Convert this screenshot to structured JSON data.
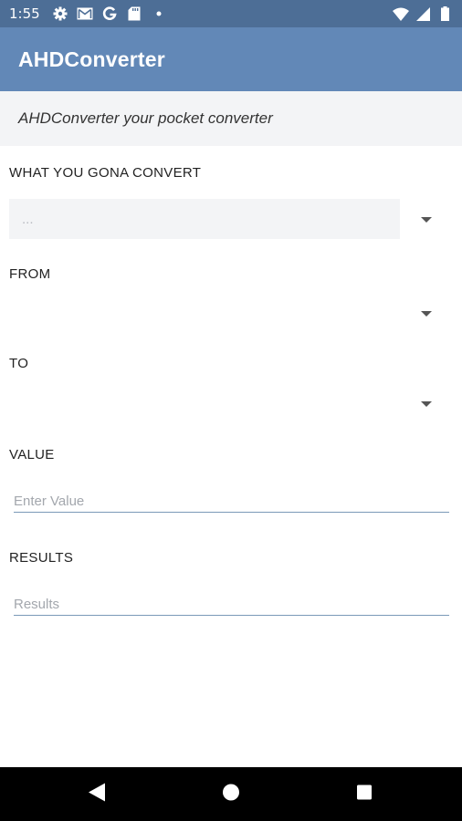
{
  "status_bar": {
    "time": "1:55",
    "left_icons": [
      "settings-icon",
      "gmail-icon",
      "google-icon",
      "sd-card-icon",
      "dot-icon"
    ],
    "right_icons": [
      "wifi-icon",
      "signal-icon",
      "battery-icon"
    ]
  },
  "app_bar": {
    "title": "AHDConverter"
  },
  "subtitle": "AHDConverter your pocket converter",
  "form": {
    "convert_label": "WHAT YOU GONA CONVERT",
    "convert_value": "...",
    "from_label": "FROM",
    "to_label": "TO",
    "value_label": "VALUE",
    "value_placeholder": "Enter Value",
    "results_label": "RESULTS",
    "results_placeholder": "Results"
  },
  "nav_bar": {
    "buttons": [
      "back-icon",
      "home-icon",
      "recents-icon"
    ]
  },
  "colors": {
    "status_bar": "#4d6e96",
    "app_bar": "#6288b7",
    "subtitle_band": "#f3f4f6",
    "field_underline": "#7a99b8"
  }
}
